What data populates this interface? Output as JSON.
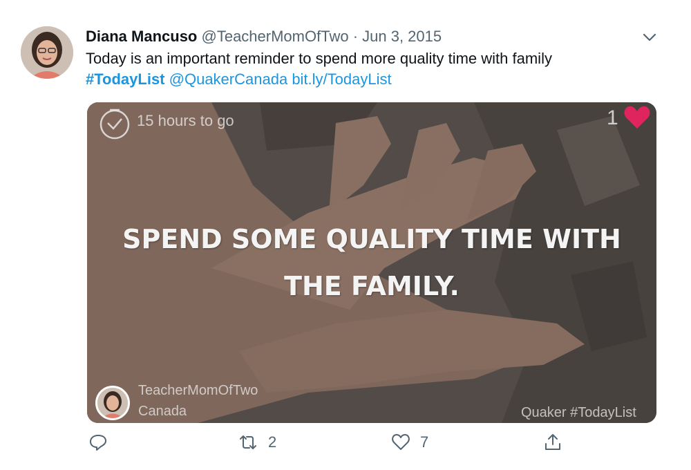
{
  "tweet": {
    "author_name": "Diana Mancuso",
    "handle": "@TeacherMomOfTwo",
    "separator": "·",
    "date": "Jun 3, 2015",
    "text_line1": "Today is an important reminder to spend more quality time with family",
    "hashtag": "#TodayList",
    "mention": "@QuakerCanada",
    "link": "bit.ly/TodayList"
  },
  "card": {
    "timer_text": "15 hours to go",
    "like_count": "1",
    "headline": "Spend some quality time with the family.",
    "username": "TeacherMomOfTwo",
    "location": "Canada",
    "brand": "Quaker #TodayList"
  },
  "actions": {
    "reply_count": "",
    "retweet_count": "2",
    "like_count": "7"
  },
  "colors": {
    "link": "#1b95e0",
    "muted": "#536471",
    "heart": "#e0245e"
  },
  "icons": [
    "chevron-down-icon",
    "clock-icon",
    "heart-icon",
    "reply-icon",
    "retweet-icon",
    "like-icon",
    "share-icon"
  ]
}
